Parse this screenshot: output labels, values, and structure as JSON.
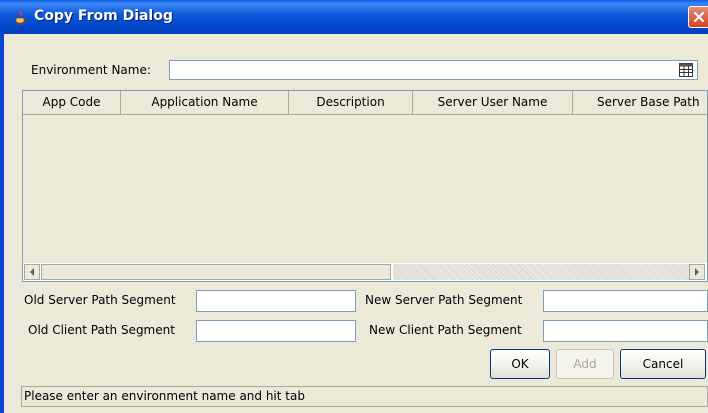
{
  "window": {
    "title": "Copy From Dialog",
    "icons": {
      "app": "java-cup-icon",
      "close": "close-icon"
    },
    "colors": {
      "titlebar": "#0a5fe6",
      "close": "#d5431f",
      "face": "#ece9d8"
    }
  },
  "environment": {
    "label": "Environment Name:",
    "value": "",
    "lookup_icon": "lookup-list-icon"
  },
  "table": {
    "columns": [
      "App Code",
      "Application Name",
      "Description",
      "Server User Name",
      "Server Base Path"
    ],
    "rows": []
  },
  "segments": {
    "old_server_label": "Old Server Path Segment",
    "new_server_label": "New Server Path Segment",
    "old_client_label": "Old Client Path Segment",
    "new_client_label": "New Client Path Segment",
    "old_server_value": "",
    "new_server_value": "",
    "old_client_value": "",
    "new_client_value": ""
  },
  "buttons": {
    "ok": "OK",
    "add": "Add",
    "cancel": "Cancel"
  },
  "status": "Please enter an environment name and hit tab"
}
